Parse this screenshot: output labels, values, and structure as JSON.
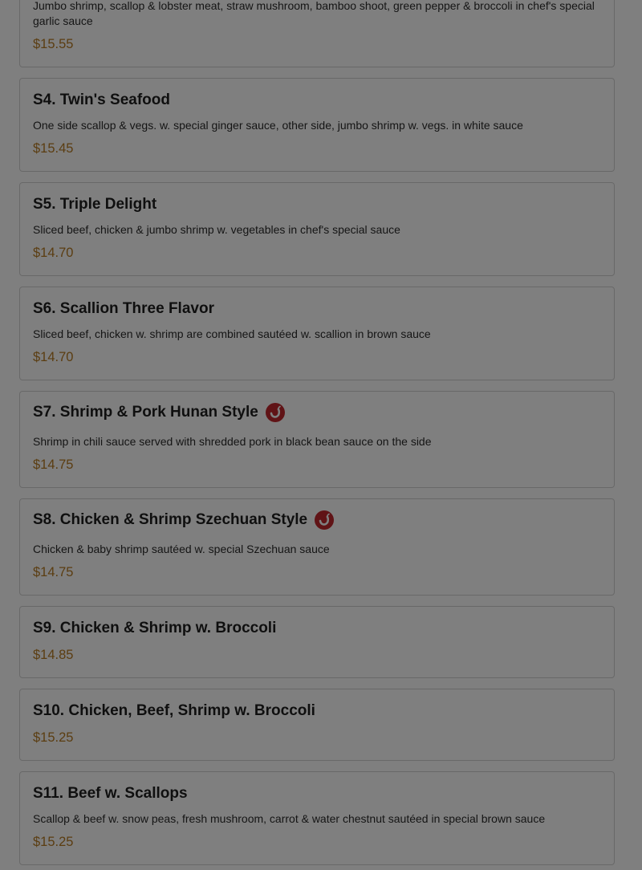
{
  "items": [
    {
      "title": "",
      "description": "Jumbo shrimp, scallop & lobster meat, straw mushroom, bamboo shoot, green pepper & broccoli in chef's special garlic sauce",
      "price": "$15.55",
      "spicy": false
    },
    {
      "title": "S4. Twin's Seafood",
      "description": "One side scallop & vegs. w. special ginger sauce, other side, jumbo shrimp w. vegs. in white sauce",
      "price": "$15.45",
      "spicy": false
    },
    {
      "title": "S5. Triple Delight",
      "description": "Sliced beef, chicken & jumbo shrimp w. vegetables in chef's special sauce",
      "price": "$14.70",
      "spicy": false
    },
    {
      "title": "S6. Scallion Three Flavor",
      "description": "Sliced beef, chicken w. shrimp are combined sautéed w. scallion in brown sauce",
      "price": "$14.70",
      "spicy": false
    },
    {
      "title": "S7. Shrimp & Pork Hunan Style",
      "description": "Shrimp in chili sauce served with shredded pork in black bean sauce on the side",
      "price": "$14.75",
      "spicy": true
    },
    {
      "title": "S8. Chicken & Shrimp Szechuan Style",
      "description": "Chicken & baby shrimp sautéed w. special Szechuan sauce",
      "price": "$14.75",
      "spicy": true
    },
    {
      "title": "S9. Chicken & Shrimp w. Broccoli",
      "description": "",
      "price": "$14.85",
      "spicy": false
    },
    {
      "title": "S10. Chicken, Beef, Shrimp w. Broccoli",
      "description": "",
      "price": "$15.25",
      "spicy": false
    },
    {
      "title": "S11. Beef w. Scallops",
      "description": "Scallop & beef w. snow peas, fresh mushroom, carrot & water chestnut sautéed in special brown sauce",
      "price": "$15.25",
      "spicy": false
    }
  ],
  "icons": {
    "spicy": "chili-pepper-icon"
  },
  "colors": {
    "price": "#b77b23",
    "spicy_badge": "#c0262c",
    "overlay": "rgba(0,0,0,0.5)"
  }
}
